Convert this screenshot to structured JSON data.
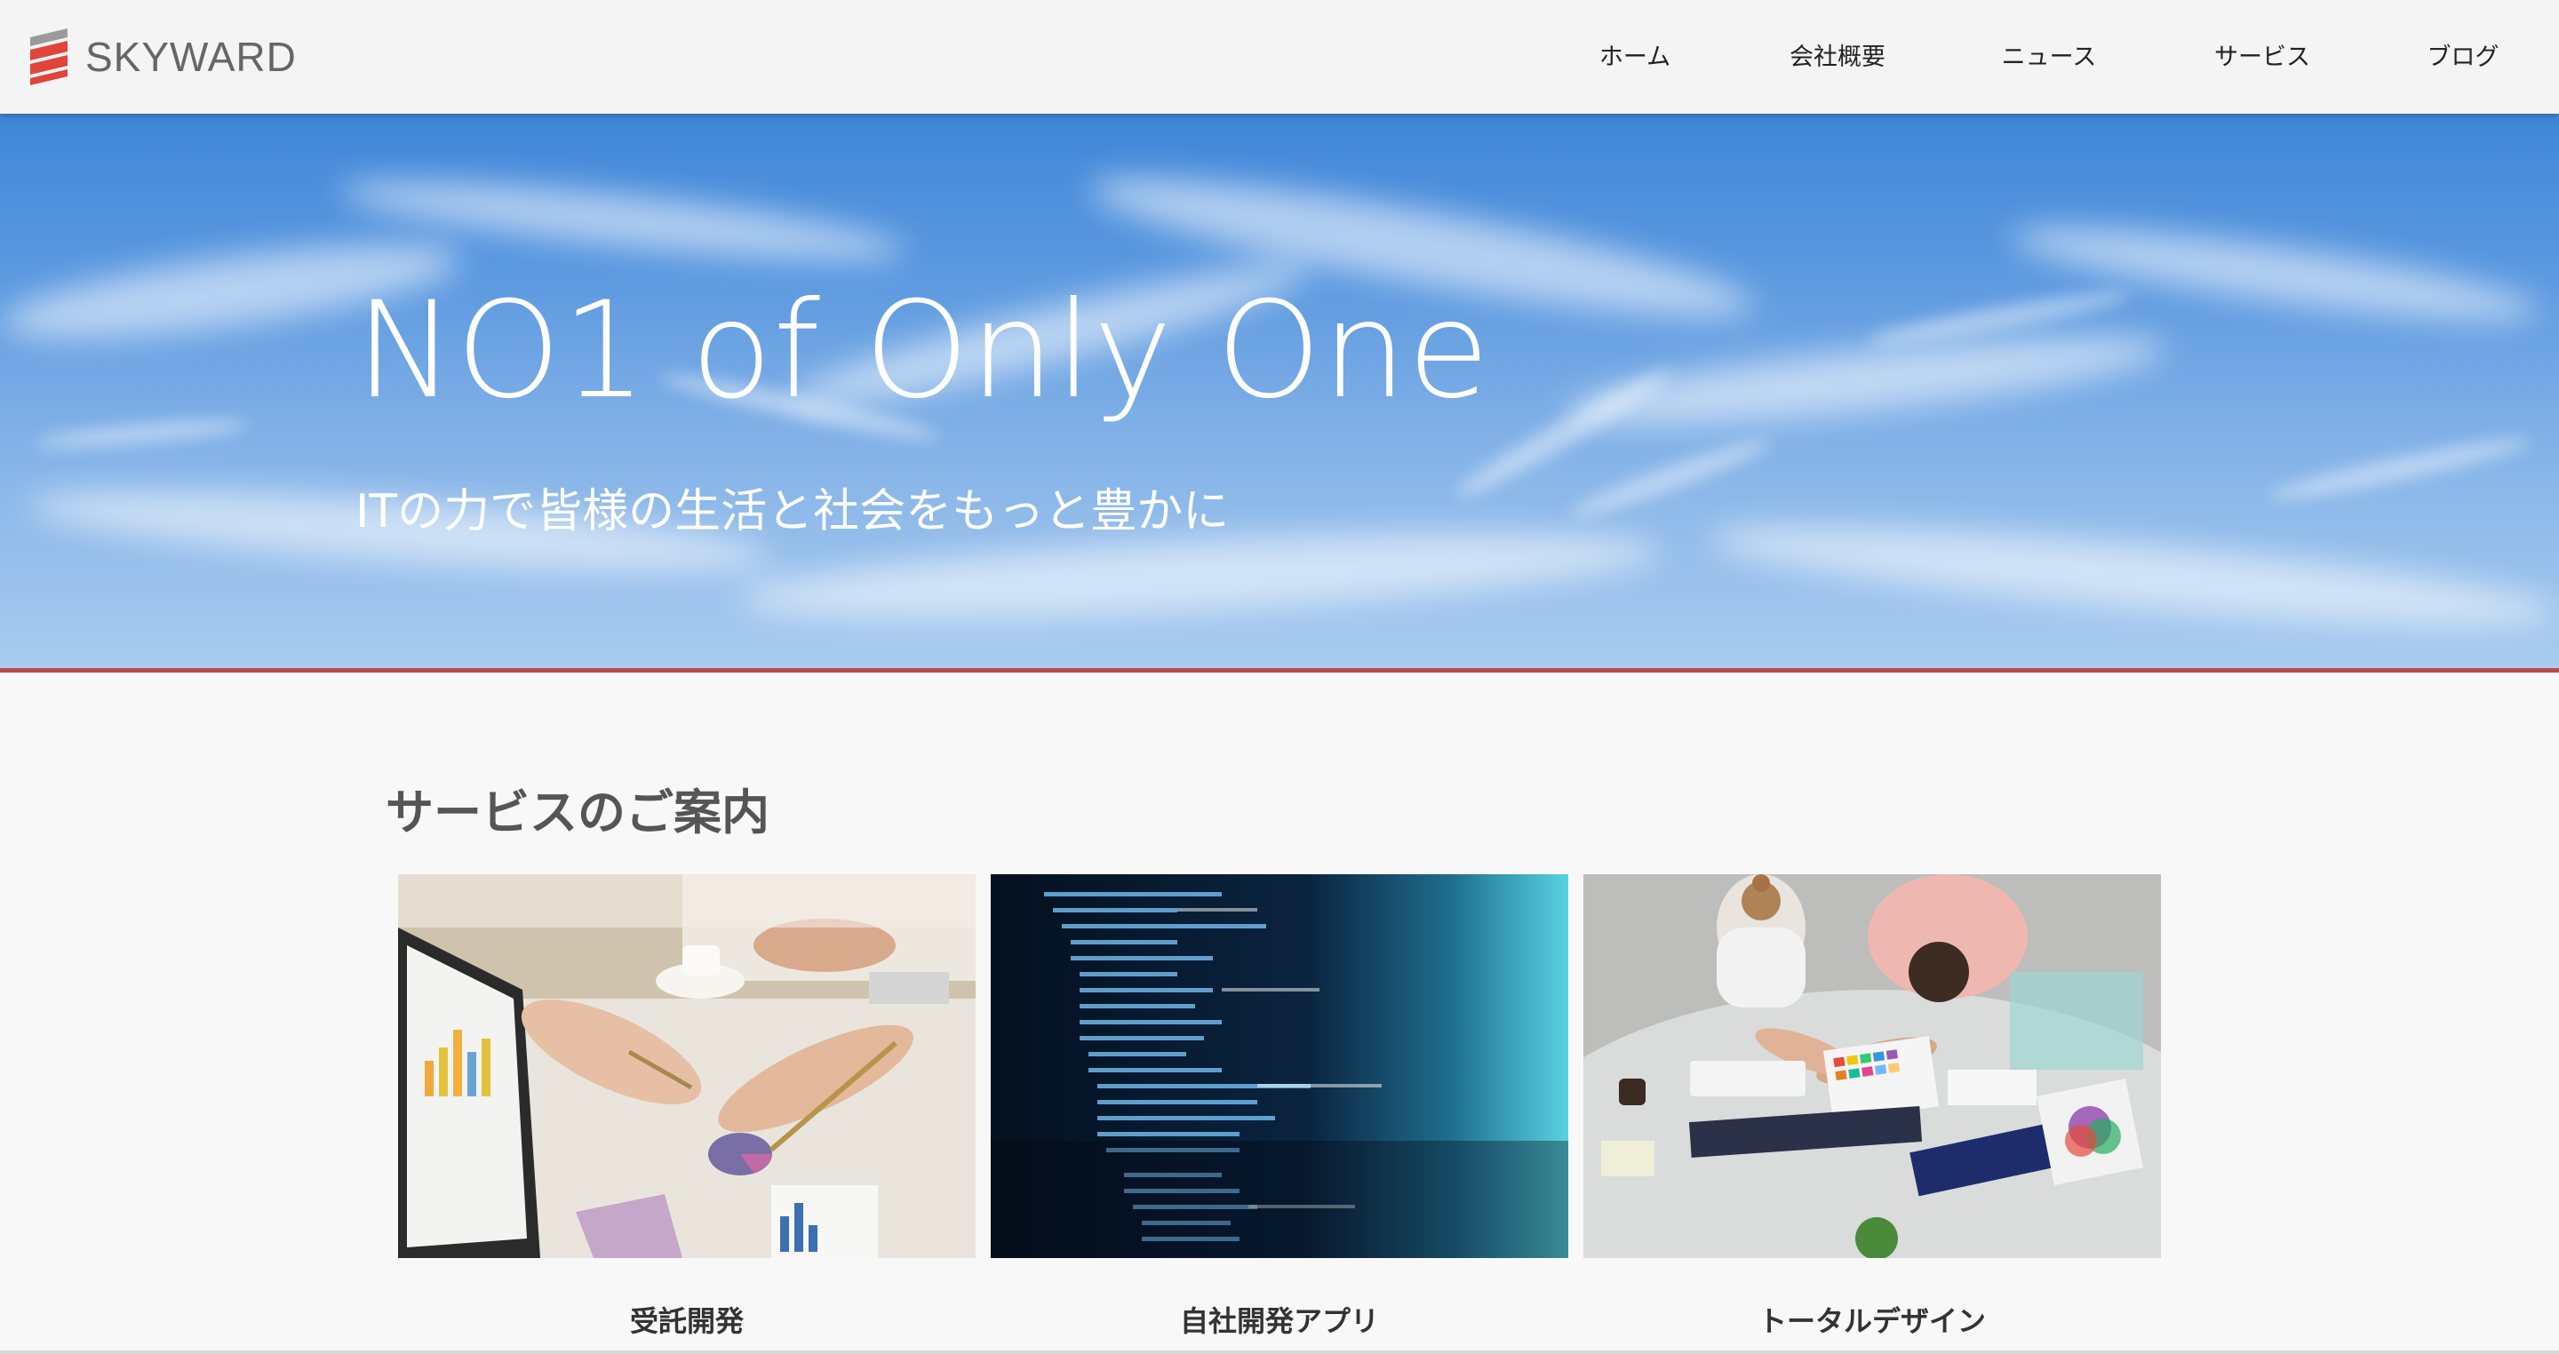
{
  "header": {
    "logo_text": "SKYWARD",
    "nav": [
      "ホーム",
      "会社概要",
      "ニュース",
      "サービス",
      "ブログ"
    ]
  },
  "hero": {
    "title": "NO1 of Only One",
    "subtitle": "ITの力で皆様の生活と社会をもっと豊かに"
  },
  "services": {
    "title": "サービスのご案内",
    "cards": [
      {
        "label": "受託開発",
        "image": "business-meeting-photo"
      },
      {
        "label": "自社開発アプリ",
        "image": "code-screen-photo"
      },
      {
        "label": "トータルデザイン",
        "image": "designers-desk-photo"
      }
    ]
  },
  "colors": {
    "accent_line": "#b94a45",
    "logo_red": "#e0443a",
    "header_bg": "#f4f4f4",
    "sky_blue": "#3f86d8"
  }
}
